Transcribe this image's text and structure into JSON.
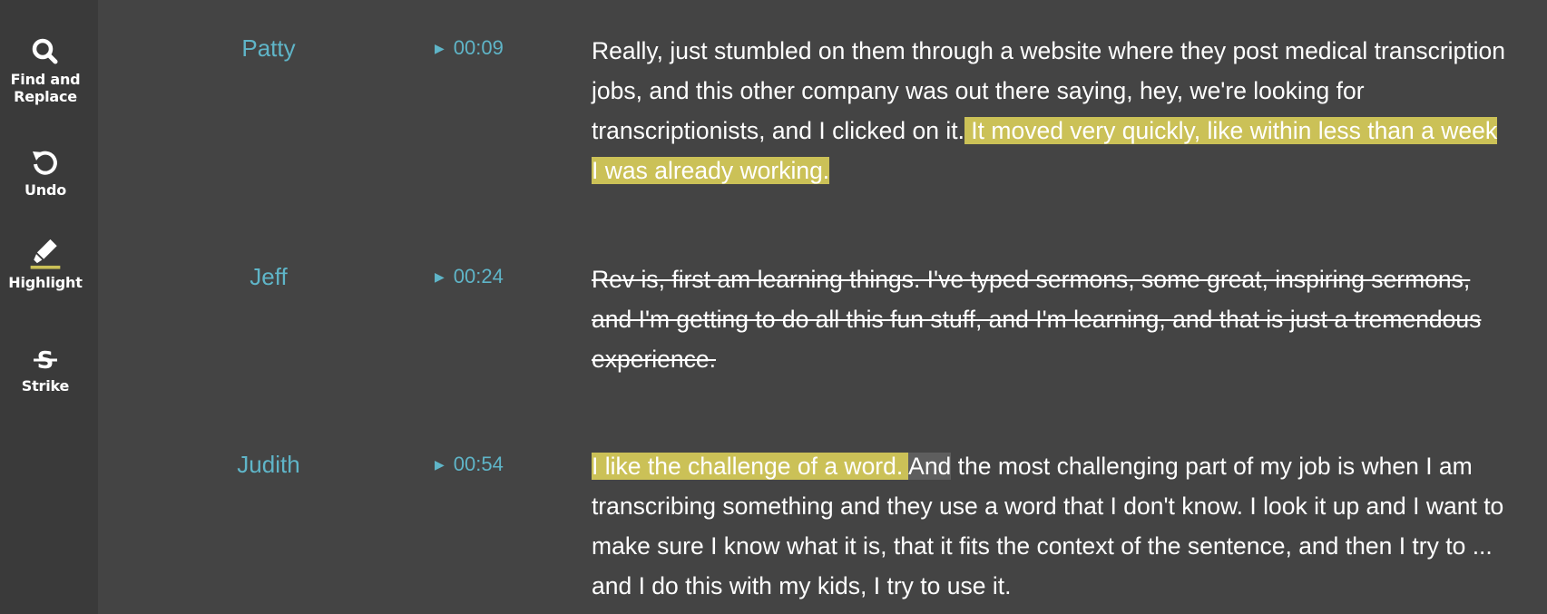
{
  "toolbar": {
    "find_label_line1": "Find and",
    "find_label_line2": "Replace",
    "undo_label": "Undo",
    "highlight_label": "Highlight",
    "strike_label": "Strike"
  },
  "colors": {
    "background": "#444444",
    "sidebar": "#3a3a3a",
    "accent": "#5fb5c8",
    "highlight": "#cbc157"
  },
  "icons": [
    "search-icon",
    "undo-icon",
    "highlighter-icon",
    "strikethrough-icon",
    "play-icon"
  ],
  "segments": [
    {
      "speaker": "Patty",
      "time": "00:09",
      "text_plain": "Really, just stumbled on them through a website where they post medical transcription jobs, and this other company was out there saying, hey, we're looking for transcriptionists, and I clicked on it.",
      "text_highlight": " It moved very quickly, like within less than a week I was already working."
    },
    {
      "speaker": "Jeff",
      "time": "00:24",
      "text_struck": "Rev is, first am learning things. I've typed sermons, some great, inspiring sermons, and I'm getting to do all this fun stuff, and I'm learning, and that is just a tremendous experience."
    },
    {
      "speaker": "Judith",
      "time": "00:54",
      "text_highlight": "I like the challenge of a word. ",
      "text_selected": "And",
      "text_plain": " the most challenging part of my job is when I am  transcribing something and they use a word that I don't know. I look it up and I want to make sure I know what it is, that it fits the context of the sentence, and then I try to ... and I do this with my kids, I try to use it."
    }
  ]
}
